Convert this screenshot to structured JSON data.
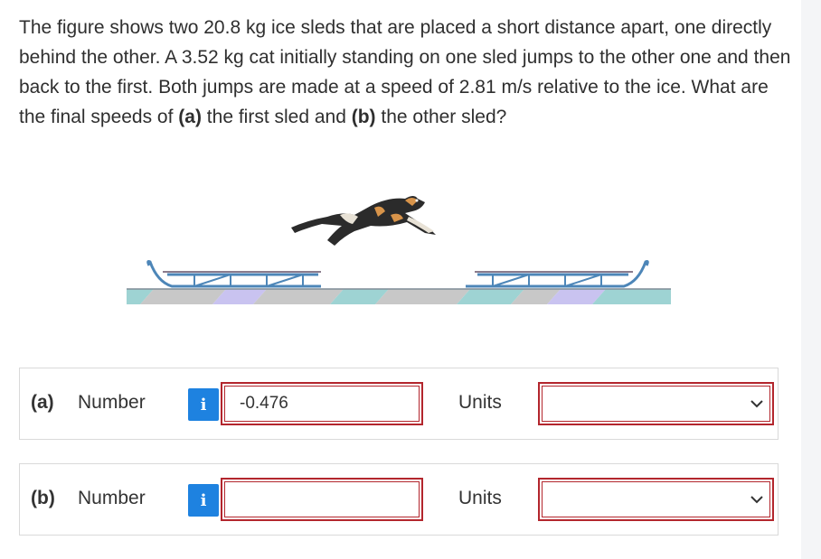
{
  "question": {
    "part1": "The figure shows two 20.8 kg ice sleds that are placed a short distance apart, one directly behind the other. A 3.52 kg cat initially standing on one sled jumps to the other one and then back to the first. Both jumps are made at a speed of 2.81 m/s relative to the ice. What are the final speeds of ",
    "bold_a": "(a)",
    "part2": " the first sled and ",
    "bold_b": "(b)",
    "part3": " the other sled?"
  },
  "answers": [
    {
      "part_label": "(a)",
      "number_label": "Number",
      "info_icon": "i",
      "value": "-0.476",
      "units_label": "Units",
      "units_value": ""
    },
    {
      "part_label": "(b)",
      "number_label": "Number",
      "info_icon": "i",
      "value": "",
      "units_label": "Units",
      "units_value": ""
    }
  ],
  "colors": {
    "input_border": "#b3262d",
    "info_button": "#1e82e0",
    "ice_teal": "#9ed3d3",
    "ice_gray": "#c8c8c8",
    "ice_lavender": "#c9c3f0",
    "sled": "#7aa6cc"
  },
  "icons": {
    "info": "info-icon",
    "select": "chevron-down-icon"
  }
}
